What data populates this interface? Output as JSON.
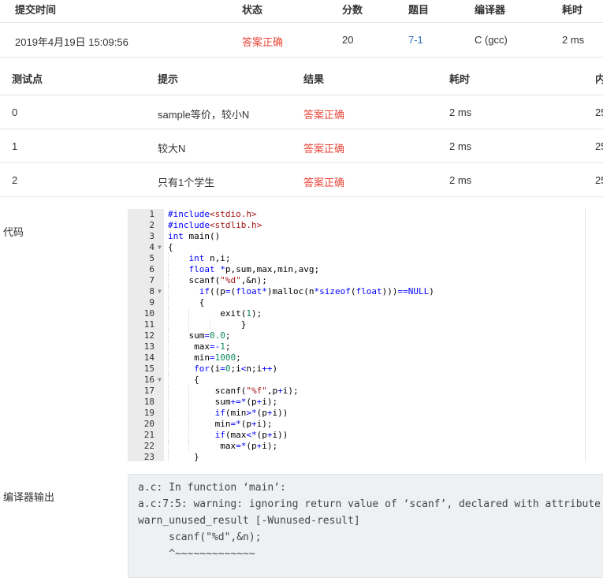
{
  "submission": {
    "headers": [
      "提交时间",
      "状态",
      "分数",
      "题目",
      "编译器",
      "耗时"
    ],
    "row": {
      "time": "2019年4月19日 15:09:56",
      "status": "答案正确",
      "score": "20",
      "problem": "7-1",
      "compiler": "C (gcc)",
      "duration": "2 ms"
    }
  },
  "tests": {
    "headers": [
      "测试点",
      "提示",
      "结果",
      "耗时",
      "内"
    ],
    "rows": [
      {
        "id": "0",
        "hint": "sample等价，较小N",
        "result": "答案正确",
        "time": "2 ms",
        "mem": "25"
      },
      {
        "id": "1",
        "hint": "较大N",
        "result": "答案正确",
        "time": "2 ms",
        "mem": "25"
      },
      {
        "id": "2",
        "hint": "只有1个学生",
        "result": "答案正确",
        "time": "2 ms",
        "mem": "25"
      }
    ]
  },
  "code_label": "代码",
  "code_lines": [
    "#include<stdio.h>",
    "#include<stdlib.h>",
    "int main()",
    "{",
    "    int n,i;",
    "    float *p,sum,max,min,avg;",
    "    scanf(\"%d\",&n);",
    "      if((p=(float*)malloc(n*sizeof(float)))==NULL)",
    "      {",
    "          exit(1);",
    "              }",
    "    sum=0.0;",
    "     max=-1;",
    "     min=1000;",
    "     for(i=0;i<n;i++)",
    "     {",
    "         scanf(\"%f\",p+i);",
    "         sum+=*(p+i);",
    "         if(min>*(p+i))",
    "         min=*(p+i);",
    "         if(max<*(p+i))",
    "          max=*(p+i);",
    "     }"
  ],
  "fold_lines": [
    4,
    8,
    16
  ],
  "compiler_label": "编译器输出",
  "compiler_output": [
    "a.c: In function ‘main’:",
    "a.c:7:5: warning: ignoring return value of ‘scanf’, declared with attribute",
    "warn_unused_result [-Wunused-result]",
    "     scanf(\"%d\",&n);",
    "     ^~~~~~~~~~~~~~"
  ],
  "colors": {
    "accepted": "#e8463a",
    "link": "#2a6ebb",
    "gutter": "#ebebeb",
    "output_bg": "#eef1f4"
  }
}
